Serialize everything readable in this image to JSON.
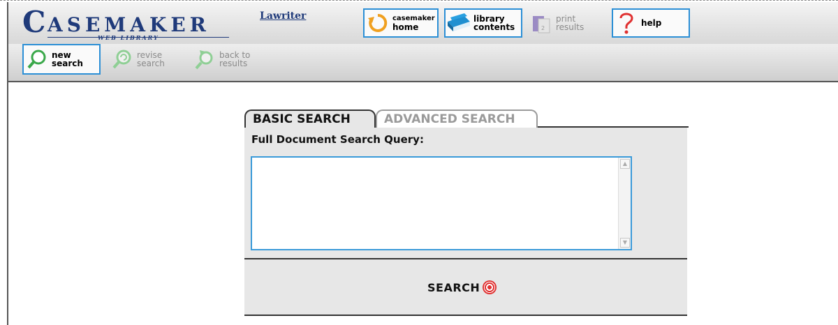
{
  "header": {
    "logo_initial": "C",
    "logo_rest": "ASEMAKER",
    "logo_sub": "WEB LIBRARY",
    "lawriter_link": "Lawriter"
  },
  "toolbar": {
    "home": {
      "line1": "casemaker",
      "line2": "home"
    },
    "contents": {
      "line1": "library",
      "line2": "contents"
    },
    "print": {
      "line1": "print",
      "line2": "results"
    },
    "help": {
      "line1": "help"
    },
    "new_search": {
      "line1": "new",
      "line2": "search"
    },
    "revise_search": {
      "line1": "revise",
      "line2": "search"
    },
    "back_results": {
      "line1": "back to",
      "line2": "results"
    }
  },
  "search": {
    "tab_basic": "BASIC SEARCH",
    "tab_advanced": "ADVANCED SEARCH",
    "query_label": "Full Document Search Query:",
    "query_value": "",
    "button_label": "SEARCH"
  },
  "colors": {
    "accent": "#2b8fd6",
    "brand": "#1f3a7a",
    "orange": "#f0a020",
    "green": "#3aa84a",
    "red": "#e03030"
  }
}
